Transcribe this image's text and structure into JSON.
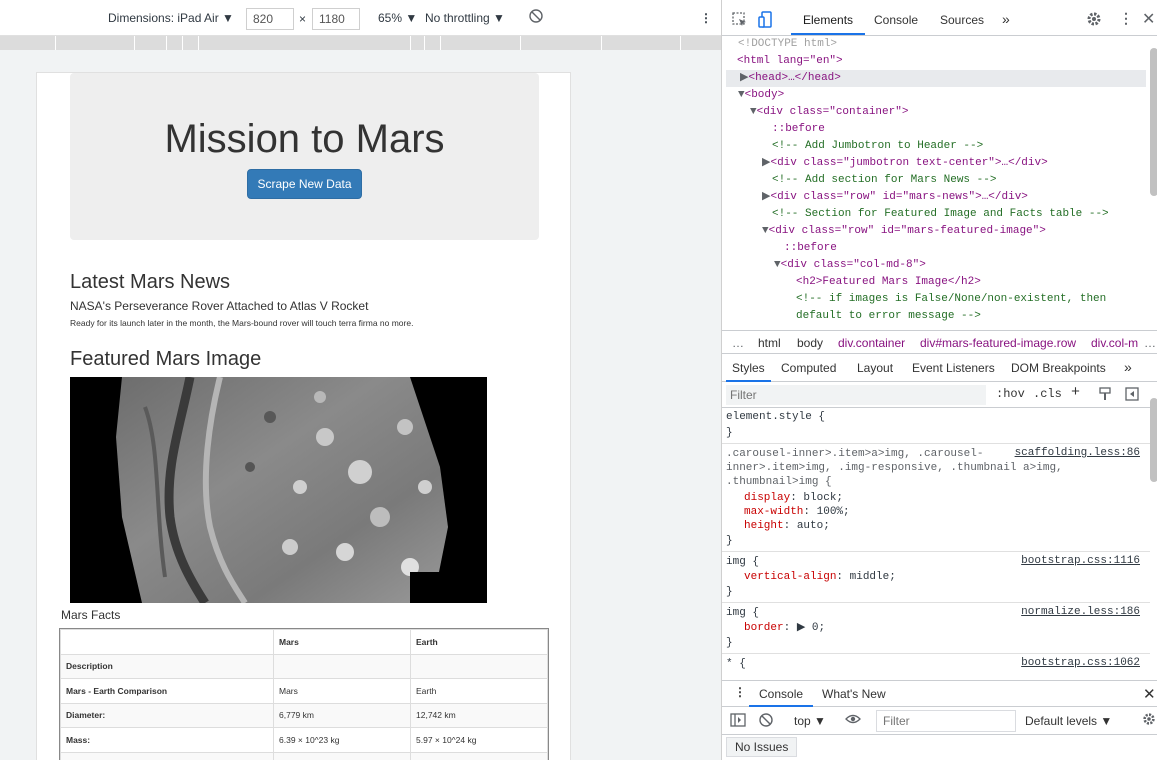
{
  "device_toolbar": {
    "dimensions": "Dimensions: iPad Air ▼",
    "width": "820",
    "times": "×",
    "height": "1180",
    "zoom": "65% ▼",
    "throttling": "No throttling ▼",
    "more": "⋮"
  },
  "page": {
    "title": "Mission to Mars",
    "scrape_button": "Scrape New Data",
    "news_heading": "Latest Mars News",
    "news_title": "NASA's Perseverance Rover Attached to Atlas V Rocket",
    "news_paragraph": "Ready for its launch later in the month, the Mars-bound rover will touch terra firma no more.",
    "featured_heading": "Featured Mars Image",
    "facts_title": "Mars Facts",
    "facts_table": {
      "headers": [
        "",
        "Mars",
        "Earth"
      ],
      "rows": [
        [
          "Description",
          "",
          ""
        ],
        [
          "Mars - Earth Comparison",
          "Mars",
          "Earth"
        ],
        [
          "Diameter:",
          "6,779 km",
          "12,742 km"
        ],
        [
          "Mass:",
          "6.39 × 10^23 kg",
          "5.97 × 10^24 kg"
        ]
      ]
    }
  },
  "devtools": {
    "tabs": [
      "Elements",
      "Console",
      "Sources",
      "»"
    ],
    "dom_lines": [
      "<!DOCTYPE html>",
      "<html lang=\"en\">",
      "<head>…</head>",
      "<body>",
      "<div class=\"container\">",
      "::before",
      "<!-- Add Jumbotron to Header -->",
      "<div class=\"jumbotron text-center\">…</div>",
      "<!-- Add section for Mars News -->",
      "<div class=\"row\" id=\"mars-news\">…</div>",
      "<!-- Section for Featured Image and Facts table -->",
      "<div class=\"row\" id=\"mars-featured-image\">",
      "::before",
      "<div class=\"col-md-8\">",
      "<h2>Featured Mars Image</h2>",
      "<!-- if images is False/None/non-existent, then",
      "default to error message -->"
    ],
    "breadcrumbs": [
      "…",
      "html",
      "body",
      "div.container",
      "div#mars-featured-image.row",
      "div.col-m",
      "…"
    ],
    "style_tabs": [
      "Styles",
      "Computed",
      "Layout",
      "Event Listeners",
      "DOM Breakpoints",
      "»"
    ],
    "filter_placeholder": "Filter",
    "hov": ":hov",
    "cls": ".cls",
    "styles": {
      "element_style": "element.style {",
      "close": "}",
      "rule1_selector_1": ".carousel-inner>.item>a>img, .carousel-",
      "rule1_selector_2": "inner>.item>img, .img-responsive, .thumbnail a>img,",
      "rule1_selector_3": ".thumbnail>img {",
      "rule1_source": "scaffolding.less:86",
      "rule1_props": [
        {
          "name": "display",
          "value": "block;"
        },
        {
          "name": "max-width",
          "value": "100%;"
        },
        {
          "name": "height",
          "value": "auto;"
        }
      ],
      "rule2_selector": "img {",
      "rule2_source": "bootstrap.css:1116",
      "rule2_prop": {
        "name": "vertical-align",
        "value": "middle;"
      },
      "rule3_selector": "img {",
      "rule3_source": "normalize.less:186",
      "rule3_prop": {
        "name": "border",
        "value": "▶ 0;"
      },
      "rule4_selector": "* {",
      "rule4_source": "bootstrap.css:1062"
    },
    "drawer_tabs": [
      "Console",
      "What's New"
    ],
    "console": {
      "context": "top ▼",
      "filter_placeholder": "Filter",
      "levels": "Default levels ▼",
      "no_issues": "No Issues"
    }
  }
}
